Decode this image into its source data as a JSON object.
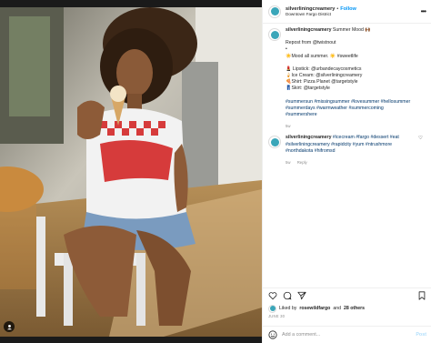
{
  "post": {
    "username": "silverliningcreamery",
    "follow_label": "Follow",
    "dot": "•",
    "location": "Downtown Fargo District"
  },
  "caption": {
    "username": "silverliningcreamery",
    "lead": "Summer Mood 🙌🏾",
    "lines": [
      "Repost from @twistnout",
      "•",
      "☀️Mood all summer. ☀️ #sweetlife",
      "",
      "💄 Lipstick: @urbandecaycosmetics",
      "🍦Ice Cream: @silverliningcreamery",
      "🍕Shirt: Pizza Planet @targetstyle",
      "👖Skirt: @targetstyle",
      "",
      "#summersun #missingsummer #lovesummer #hellosummer",
      "#summerdays #warmweather #summercoming",
      "#summershere"
    ],
    "meta_time": "5w"
  },
  "comment": {
    "username": "silverliningcreamery",
    "text": "#icecream #fargo #dessert #eat #silverliningcreamery #rapidcity #yum #ntrushmore #northdakota #hifromsd",
    "meta_time": "5w",
    "reply_label": "Reply"
  },
  "likes": {
    "prefix": "Liked by",
    "user": "rosewildfargo",
    "middle": "and",
    "others": "28 others"
  },
  "date": "JUNE 30",
  "add_comment": {
    "placeholder": "Add a comment...",
    "post_label": "Post"
  },
  "icons": {
    "more": "more-horizontal-icon",
    "heart": "heart-icon",
    "comment": "comment-icon",
    "share": "share-icon",
    "save": "save-icon",
    "emoji": "emoji-icon",
    "user_tag": "user-tag-icon"
  },
  "colors": {
    "link": "#00376b",
    "follow": "#0095f6",
    "muted": "#8e8e8e",
    "post_disabled": "#b2dffc"
  }
}
